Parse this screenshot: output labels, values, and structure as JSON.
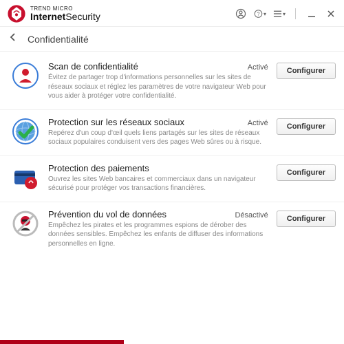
{
  "brand": {
    "small": "TREND MICRO",
    "main_bold": "Internet",
    "main_light": "Security"
  },
  "header": {
    "page_title": "Confidentialité"
  },
  "buttons": {
    "configure": "Configurer"
  },
  "items": [
    {
      "title": "Scan de confidentialité",
      "status": "Activé",
      "desc": "Évitez de partager trop d'informations personnelles sur les sites de réseaux sociaux et réglez les paramètres de votre navigateur Web pour vous aider à protéger votre confidentialité."
    },
    {
      "title": "Protection sur les réseaux sociaux",
      "status": "Activé",
      "desc": "Repérez d'un coup d'œil quels liens partagés sur les sites de réseaux sociaux populaires conduisent vers des pages Web sûres ou à risque."
    },
    {
      "title": "Protection des paiements",
      "status": "",
      "desc": "Ouvrez les sites Web bancaires et commerciaux dans un navigateur sécurisé pour protéger vos transactions financières."
    },
    {
      "title": "Prévention du vol de données",
      "status": "Désactivé",
      "desc": "Empêchez les pirates et les programmes espions de dérober des données sensibles. Empêchez les enfants de diffuser des informations personnelles en ligne."
    }
  ]
}
